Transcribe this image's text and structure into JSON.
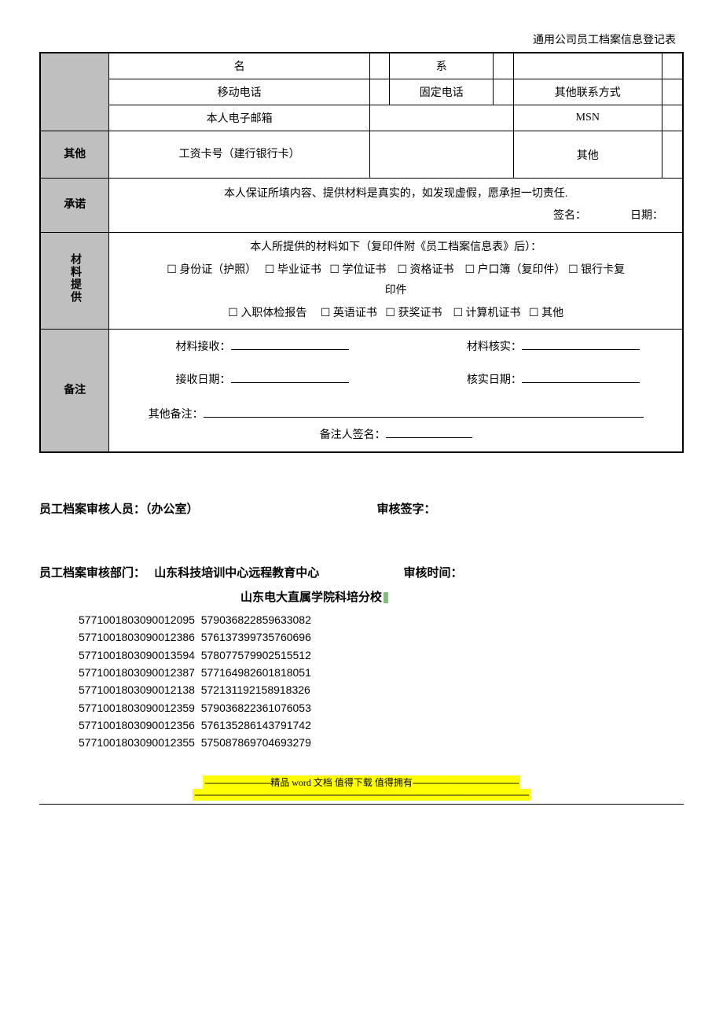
{
  "header": {
    "title": "通用公司员工档案信息登记表"
  },
  "rows": {
    "r1": {
      "name_label": "名",
      "relation_label": "系"
    },
    "r2": {
      "mobile_label": "移动电话",
      "fixed_label": "固定电话",
      "other_contact_label": "其他联系方式"
    },
    "r3": {
      "email_label": "本人电子邮箱",
      "msn_label": "MSN"
    },
    "other_section": {
      "side": "其他",
      "salary_card_label": "工资卡号（建行银行卡）",
      "other_label": "其他"
    },
    "commitment": {
      "side": "承诺",
      "text": "本人保证所填内容、提供材料是真实的，如发现虚假，愿承担一切责任.",
      "sign_label": "签名：",
      "date_label": "日期："
    },
    "materials": {
      "side": "材料提供",
      "intro": "本人所提供的材料如下（复印件附《员工档案信息表》后）：",
      "line1_items": [
        "身份证（护照）",
        "毕业证书",
        "学位证书",
        "资格证书",
        "户口簿（复印件）",
        "银行卡复"
      ],
      "line1_suffix": "印件",
      "line2_items": [
        "入职体检报告",
        "英语证书",
        "获奖证书",
        "计算机证书",
        "其他"
      ]
    },
    "remarks": {
      "side": "备注",
      "receive_label": "材料接收：",
      "verify_label": "材料核实：",
      "receive_date_label": "接收日期：",
      "verify_date_label": "核实日期：",
      "other_remarks_label": "其他备注：",
      "remarker_sign_label": "备注人签名："
    }
  },
  "below": {
    "reviewer_label": "员工档案审核人员：（办公室）",
    "review_sign_label": "审核签字：",
    "dept_label": "员工档案审核部门：",
    "dept_value1": "山东科技培训中心远程教育中心",
    "review_time_label": "审核时间：",
    "dept_value2": "山东电大直属学院科培分校"
  },
  "numbers": [
    [
      "5771001803090012095",
      "579036822859633082"
    ],
    [
      "5771001803090012386",
      "576137399735760696"
    ],
    [
      "5771001803090013594",
      "578077579902515512"
    ],
    [
      "5771001803090012387",
      "577164982601818051"
    ],
    [
      "5771001803090012138",
      "572131192158918326"
    ],
    [
      "5771001803090012359",
      "579036822361076053"
    ],
    [
      "5771001803090012356",
      "576135286143791742"
    ],
    [
      "5771001803090012355",
      "575087869704693279"
    ]
  ],
  "footer": {
    "line1_prefix": "----------------------------",
    "line1_text": "精品 word 文档  值得下载  值得拥有",
    "line1_suffix": "---------------------------------------------",
    "line2": "----------------------------------------------------------------------------------------------------------------------------------------------"
  }
}
